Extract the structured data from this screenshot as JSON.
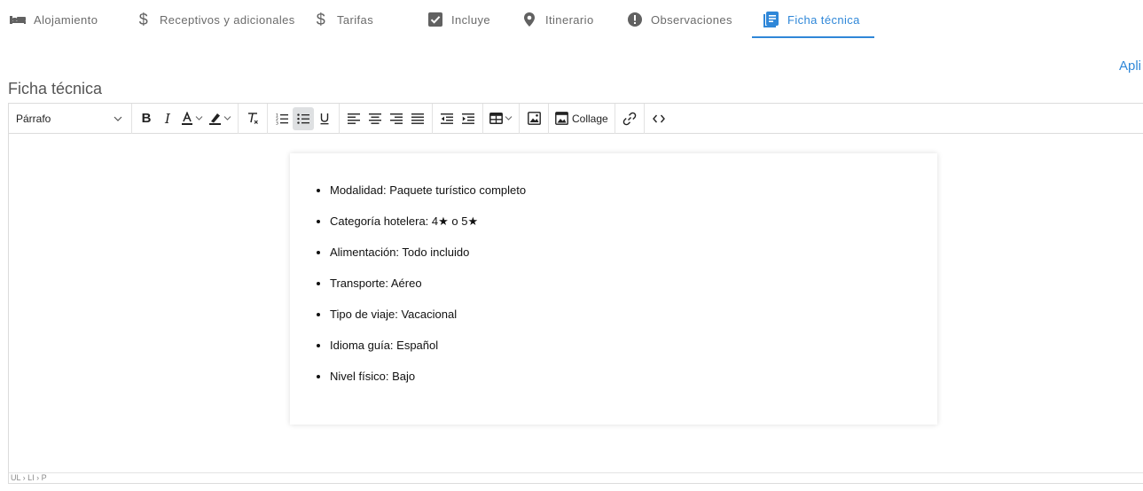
{
  "tabs": [
    {
      "label": "Alojamiento",
      "icon": "bed-icon"
    },
    {
      "label": "Receptivos y adicionales",
      "icon": "dollar-icon"
    },
    {
      "label": "Tarifas",
      "icon": "dollar-icon"
    },
    {
      "label": "Incluye",
      "icon": "checkbox-icon"
    },
    {
      "label": "Itinerario",
      "icon": "location-pin-icon"
    },
    {
      "label": "Observaciones",
      "icon": "alert-circle-icon"
    },
    {
      "label": "Ficha técnica",
      "icon": "document-icon",
      "active": true
    }
  ],
  "apply_link": "Apli",
  "section_title": "Ficha técnica",
  "toolbar": {
    "block_format": "Párrafo",
    "collage_label": "Collage"
  },
  "content": {
    "items": [
      "Modalidad: Paquete turístico completo",
      "Categoría hotelera: 4★ o 5★",
      "Alimentación: Todo incluido",
      "Transporte: Aéreo",
      "Tipo de viaje: Vacacional",
      "Idioma guía: Español",
      "Nivel físico: Bajo"
    ]
  },
  "statusbar": {
    "path": "UL › LI › P"
  },
  "colors": {
    "accent": "#2f87d8",
    "tab_text": "#6b6b6b",
    "active_button_bg": "#dee0e2"
  }
}
